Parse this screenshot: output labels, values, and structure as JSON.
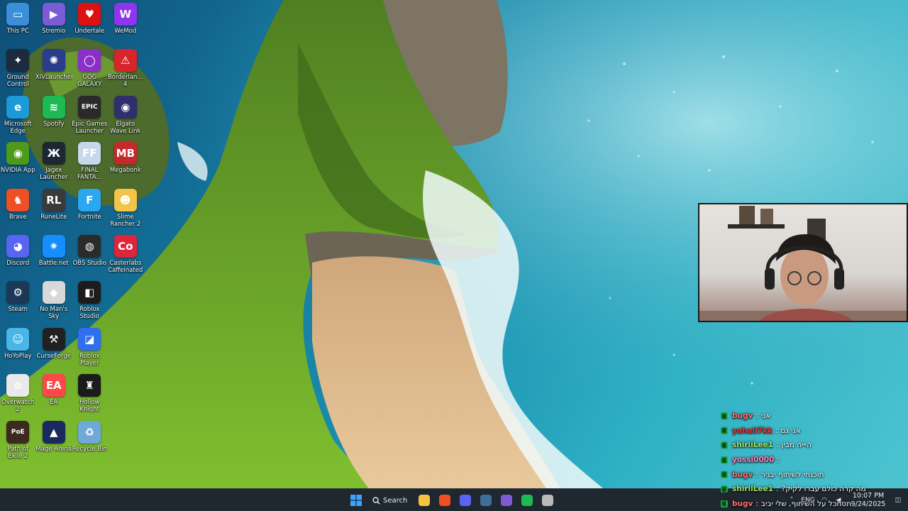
{
  "desktop": {
    "icons": [
      {
        "label": "This PC",
        "icon": "monitor-icon",
        "color": "#3a8fd8",
        "glyph": "▭"
      },
      {
        "label": "Ground Control",
        "icon": "ground-control-icon",
        "color": "#1c2a3e",
        "glyph": "✦"
      },
      {
        "label": "Microsoft Edge",
        "icon": "edge-icon",
        "color": "#1c9ad6",
        "glyph": "e"
      },
      {
        "label": "NVIDIA App",
        "icon": "nvidia-icon",
        "color": "#4e9a1a",
        "glyph": "◉"
      },
      {
        "label": "Brave",
        "icon": "brave-icon",
        "color": "#f04e23",
        "glyph": "♞"
      },
      {
        "label": "Discord",
        "icon": "discord-icon",
        "color": "#5865f2",
        "glyph": "◕"
      },
      {
        "label": "Steam",
        "icon": "steam-icon",
        "color": "#1b3856",
        "glyph": "⚙"
      },
      {
        "label": "HoYoPlay",
        "icon": "hoyoplay-icon",
        "color": "#49b6e8",
        "glyph": "☺"
      },
      {
        "label": "Overwatch 2",
        "icon": "overwatch-icon",
        "color": "#e9e9e9",
        "glyph": "⊘"
      },
      {
        "label": "Path of Exile 2",
        "icon": "path-of-exile-icon",
        "color": "#3b2a1f",
        "glyph": "PoE"
      },
      {
        "label": "Stremio",
        "icon": "stremio-icon",
        "color": "#7b5bd6",
        "glyph": "▶"
      },
      {
        "label": "XIVLauncher",
        "icon": "xivlauncher-icon",
        "color": "#2a3d8c",
        "glyph": "✺"
      },
      {
        "label": "Spotify",
        "icon": "spotify-icon",
        "color": "#1db954",
        "glyph": "≋"
      },
      {
        "label": "Jagex Launcher",
        "icon": "jagex-icon",
        "color": "#1c2733",
        "glyph": "Ж"
      },
      {
        "label": "RuneLite",
        "icon": "runelite-icon",
        "color": "#3a3a3a",
        "glyph": "RL"
      },
      {
        "label": "Battle.net",
        "icon": "battlenet-icon",
        "color": "#148eff",
        "glyph": "✷"
      },
      {
        "label": "No Man's Sky",
        "icon": "no-mans-sky-icon",
        "color": "#d8d8d8",
        "glyph": "◆"
      },
      {
        "label": "CurseForge",
        "icon": "curseforge-icon",
        "color": "#202020",
        "glyph": "⚒"
      },
      {
        "label": "EA",
        "icon": "ea-icon",
        "color": "#ff4747",
        "glyph": "EA"
      },
      {
        "label": "Mage Arena",
        "icon": "mage-arena-icon",
        "color": "#1a2a5e",
        "glyph": "▲"
      },
      {
        "label": "Undertale",
        "icon": "undertale-icon",
        "color": "#d11",
        "glyph": "♥"
      },
      {
        "label": "GOG GALAXY",
        "icon": "gog-galaxy-icon",
        "color": "#8b2fc9",
        "glyph": "◯"
      },
      {
        "label": "Epic Games Launcher",
        "icon": "epic-games-icon",
        "color": "#2a2a2a",
        "glyph": "EPIC"
      },
      {
        "label": "FINAL FANTA...",
        "icon": "final-fantasy-icon",
        "color": "#c8d8ec",
        "glyph": "FF"
      },
      {
        "label": "Fortnite",
        "icon": "fortnite-icon",
        "color": "#2aa7f0",
        "glyph": "F"
      },
      {
        "label": "OBS Studio",
        "icon": "obs-icon",
        "color": "#2b2b2b",
        "glyph": "◍"
      },
      {
        "label": "Roblox Studio",
        "icon": "roblox-studio-icon",
        "color": "#1c1c1c",
        "glyph": "◧"
      },
      {
        "label": "Roblox Player",
        "icon": "roblox-player-icon",
        "color": "#2f6ff0",
        "glyph": "◪"
      },
      {
        "label": "Hollow Knight",
        "icon": "hollow-knight-icon",
        "color": "#1b1b1b",
        "glyph": "♜"
      },
      {
        "label": "Recycle Bin",
        "icon": "recycle-bin-icon",
        "color": "#6ea9d8",
        "glyph": "♻"
      },
      {
        "label": "WeMod",
        "icon": "wemod-icon",
        "color": "#8f35ee",
        "glyph": "W"
      },
      {
        "label": "Borderlan... 4",
        "icon": "borderlands-icon",
        "color": "#d6262b",
        "glyph": "⚠"
      },
      {
        "label": "Elgato Wave Link",
        "icon": "elgato-wave-icon",
        "color": "#2f2f6e",
        "glyph": "◉"
      },
      {
        "label": "Megabonk",
        "icon": "megabonk-icon",
        "color": "#c52a2a",
        "glyph": "MB"
      },
      {
        "label": "Slime Rancher 2",
        "icon": "slime-rancher-icon",
        "color": "#f2c54a",
        "glyph": "☻"
      },
      {
        "label": "Casterlabs Caffeinated",
        "icon": "casterlabs-icon",
        "color": "#e0243a",
        "glyph": "Co"
      }
    ]
  },
  "chat": {
    "messages": [
      {
        "user": "bugv",
        "text": "אני",
        "color": "#ff6e6e"
      },
      {
        "user": "yahali7kk",
        "text": "אני גם",
        "color": "#ff2d2d"
      },
      {
        "user": "shirliLee1",
        "text": "היייה מבין",
        "color": "#9be36a"
      },
      {
        "user": "yossi0000",
        "text": "",
        "color": "#ff7fbf"
      },
      {
        "user": "bugv",
        "text": "תוכנתי לשיתוף יבניר",
        "color": "#ff6e6e"
      },
      {
        "user": "shirliLee1",
        "text": "מה קרה כולם עברו לקיק?",
        "color": "#9be36a"
      },
      {
        "user": "bugv",
        "text": "תסתכל על השיתוף, שלי יביב",
        "color": "#ff6e6e"
      }
    ]
  },
  "taskbar": {
    "search_label": "Search",
    "apps": [
      {
        "name": "file-explorer",
        "icon": "folder-icon",
        "color": "#f5c242"
      },
      {
        "name": "brave",
        "icon": "brave-icon",
        "color": "#f04e23"
      },
      {
        "name": "discord",
        "icon": "discord-icon",
        "color": "#5865f2"
      },
      {
        "name": "steam",
        "icon": "steam-icon",
        "color": "#3d6e9c"
      },
      {
        "name": "stremio",
        "icon": "stremio-icon",
        "color": "#7b5bd6"
      },
      {
        "name": "spotify",
        "icon": "spotify-icon",
        "color": "#1db954"
      },
      {
        "name": "obs-studio",
        "icon": "obs-icon",
        "color": "#b9b9b9"
      }
    ],
    "language": "ENG",
    "time": "10:07 PM",
    "date": "9/24/2025"
  }
}
